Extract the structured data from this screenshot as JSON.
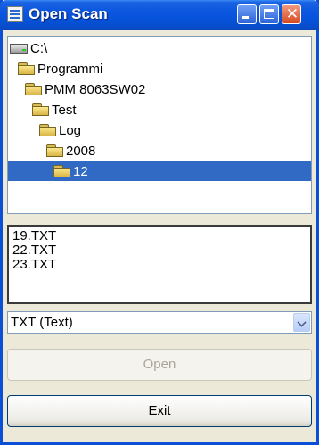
{
  "window": {
    "title": "Open Scan"
  },
  "tree": {
    "items": [
      {
        "label": "C:\\",
        "icon": "drive-icon"
      },
      {
        "label": "Programmi",
        "icon": "folder-icon"
      },
      {
        "label": "PMM 8063SW02",
        "icon": "folder-icon"
      },
      {
        "label": "Test",
        "icon": "folder-icon"
      },
      {
        "label": "Log",
        "icon": "folder-icon"
      },
      {
        "label": "2008",
        "icon": "folder-icon"
      },
      {
        "label": "12",
        "icon": "folder-open-icon",
        "selected": true
      }
    ]
  },
  "files": {
    "items": [
      "19.TXT",
      "22.TXT",
      "23.TXT"
    ]
  },
  "filter": {
    "value": "TXT (Text)"
  },
  "buttons": {
    "open": "Open",
    "exit": "Exit"
  },
  "colors": {
    "selection": "#316ac5",
    "titlebar": "#0b55e0",
    "window_bg": "#ece9d8"
  }
}
